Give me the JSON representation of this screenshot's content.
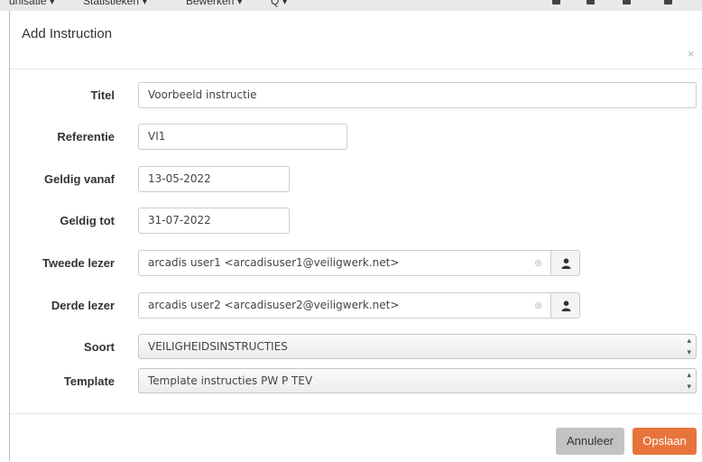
{
  "background_menu": {
    "items": [
      "unisatie ▾",
      "Statistieken ▾",
      "Bewerken ▾",
      "Q ▾"
    ]
  },
  "modal": {
    "title": "Add Instruction",
    "close_label": "×"
  },
  "form": {
    "titel": {
      "label": "Titel",
      "value": "Voorbeeld instructie"
    },
    "referentie": {
      "label": "Referentie",
      "value": "VI1"
    },
    "geldig_vanaf": {
      "label": "Geldig vanaf",
      "value": "13-05-2022"
    },
    "geldig_tot": {
      "label": "Geldig tot",
      "value": "31-07-2022"
    },
    "tweede_lezer": {
      "label": "Tweede lezer",
      "value": "arcadis user1 <arcadisuser1@veiligwerk.net>"
    },
    "derde_lezer": {
      "label": "Derde lezer",
      "value": "arcadis user2 <arcadisuser2@veiligwerk.net>"
    },
    "soort": {
      "label": "Soort",
      "value": "VEILIGHEIDSINSTRUCTIES"
    },
    "template": {
      "label": "Template",
      "value": "Template instructies PW P TEV"
    }
  },
  "icons": {
    "clear": "circle-x-icon",
    "person": "user-icon",
    "select_arrows": "up-down-arrows-icon"
  },
  "footer": {
    "cancel_label": "Annuleer",
    "save_label": "Opslaan"
  },
  "colors": {
    "save_button": "#e8743b",
    "cancel_button": "#c2c2c2"
  }
}
